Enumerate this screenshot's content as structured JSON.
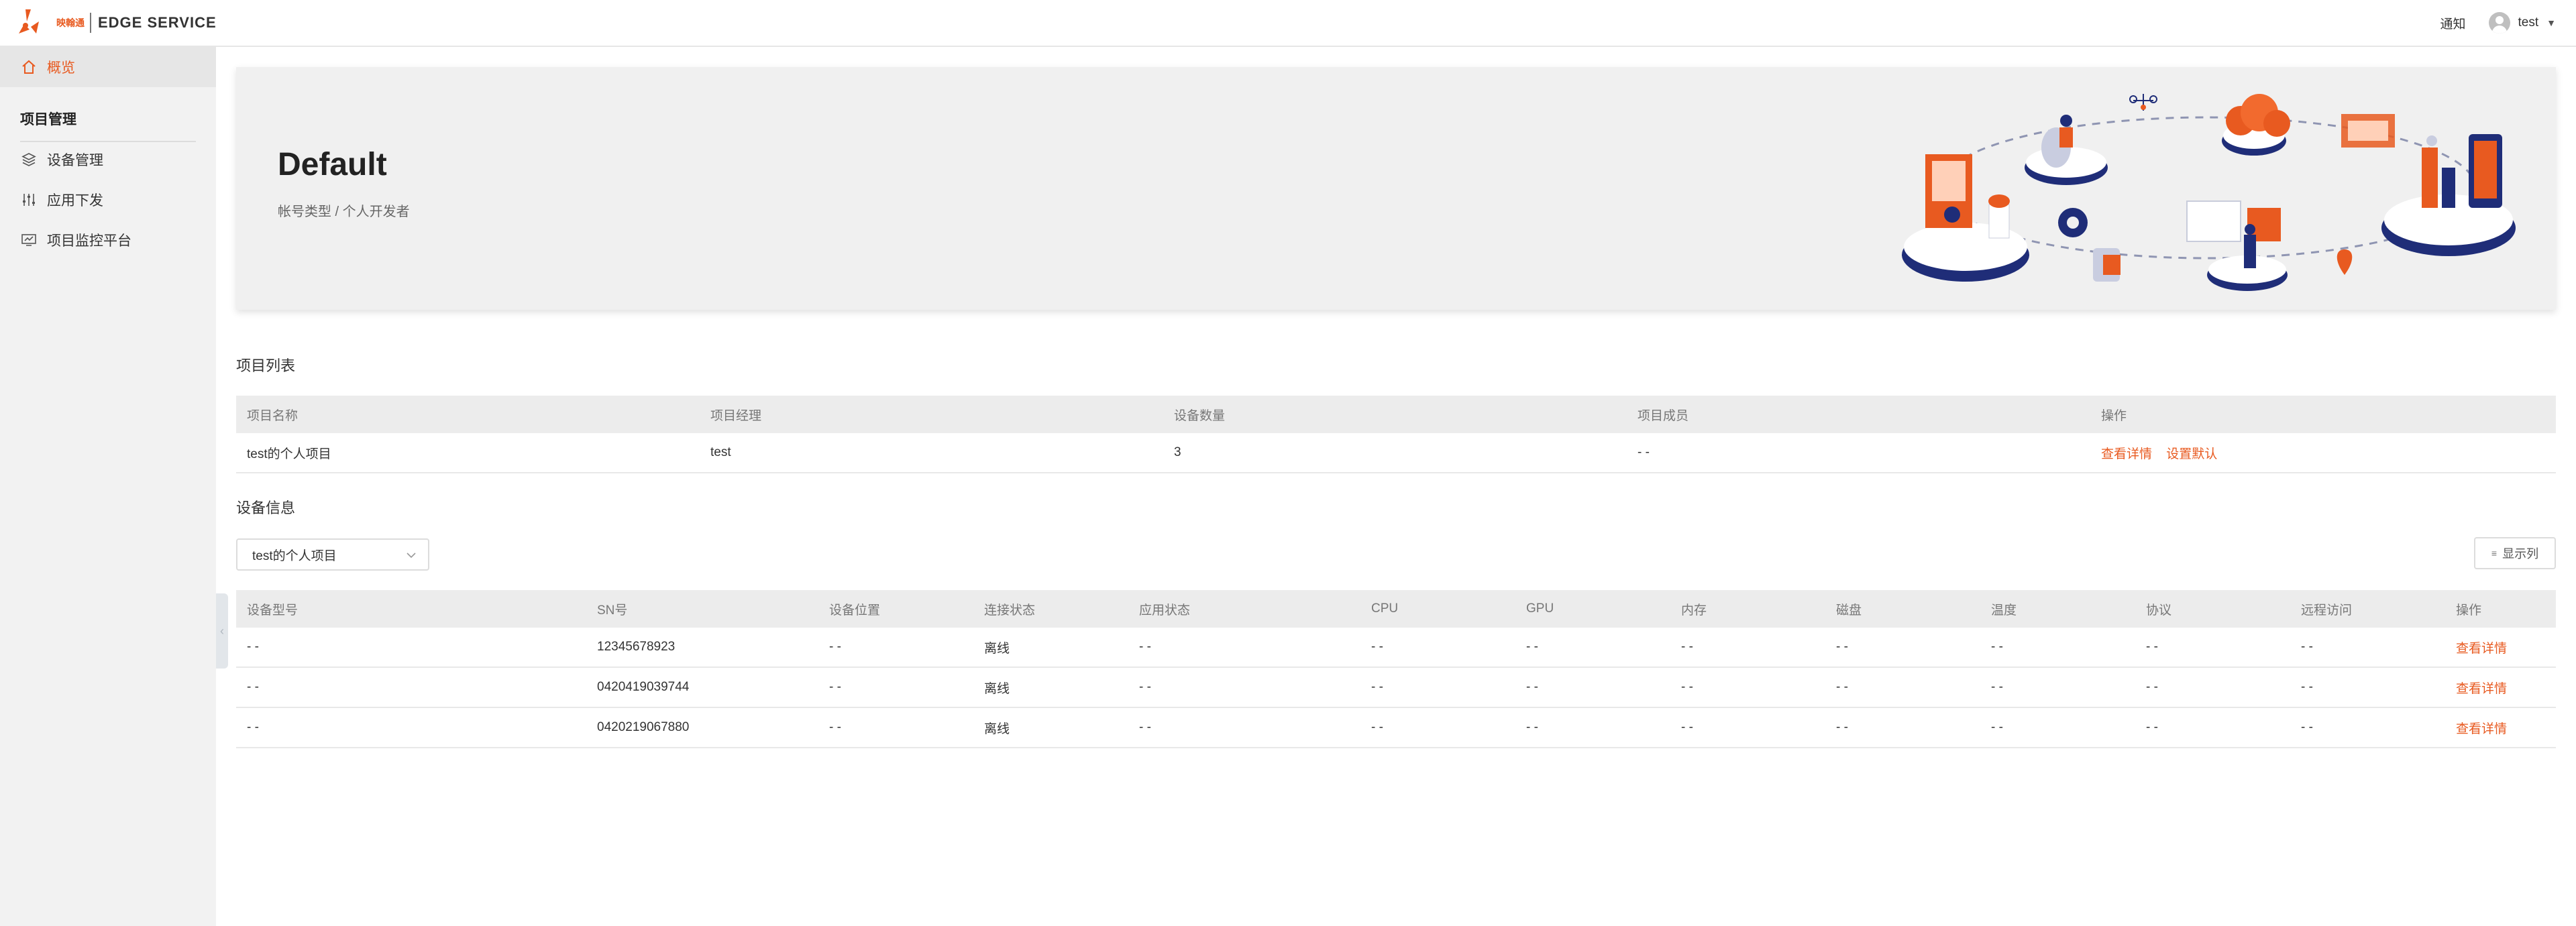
{
  "header": {
    "logo_cn": "映翰通",
    "logo_text": "EDGE SERVICE",
    "notice": "通知",
    "username": "test"
  },
  "sidebar": {
    "overview": "概览",
    "section": "项目管理",
    "items": [
      {
        "label": "设备管理",
        "icon": "cube-icon"
      },
      {
        "label": "应用下发",
        "icon": "sliders-icon"
      },
      {
        "label": "项目监控平台",
        "icon": "monitor-icon"
      }
    ]
  },
  "banner": {
    "title": "Default",
    "subtitle": "帐号类型 / 个人开发者"
  },
  "projects": {
    "title": "项目列表",
    "columns": [
      "项目名称",
      "项目经理",
      "设备数量",
      "项目成员",
      "操作"
    ],
    "rows": [
      {
        "name": "test的个人项目",
        "manager": "test",
        "devices": "3",
        "members": "- -",
        "actions": [
          "查看详情",
          "设置默认"
        ]
      }
    ]
  },
  "devices": {
    "title": "设备信息",
    "select_value": "test的个人项目",
    "columns_button": "显示列",
    "columns": [
      "设备型号",
      "SN号",
      "设备位置",
      "连接状态",
      "应用状态",
      "CPU",
      "GPU",
      "内存",
      "磁盘",
      "温度",
      "协议",
      "远程访问",
      "操作"
    ],
    "rows": [
      {
        "model": "- -",
        "sn": "12345678923",
        "location": "- -",
        "conn": "离线",
        "app": "- -",
        "cpu": "- -",
        "gpu": "- -",
        "mem": "- -",
        "disk": "- -",
        "temp": "- -",
        "proto": "- -",
        "remote": "- -",
        "action": "查看详情"
      },
      {
        "model": "- -",
        "sn": "0420419039744",
        "location": "- -",
        "conn": "离线",
        "app": "- -",
        "cpu": "- -",
        "gpu": "- -",
        "mem": "- -",
        "disk": "- -",
        "temp": "- -",
        "proto": "- -",
        "remote": "- -",
        "action": "查看详情"
      },
      {
        "model": "- -",
        "sn": "0420219067880",
        "location": "- -",
        "conn": "离线",
        "app": "- -",
        "cpu": "- -",
        "gpu": "- -",
        "mem": "- -",
        "disk": "- -",
        "temp": "- -",
        "proto": "- -",
        "remote": "- -",
        "action": "查看详情"
      }
    ]
  },
  "colors": {
    "accent": "#e85a20",
    "navy": "#1f2d78",
    "sidebar_bg": "#f2f2f2"
  }
}
